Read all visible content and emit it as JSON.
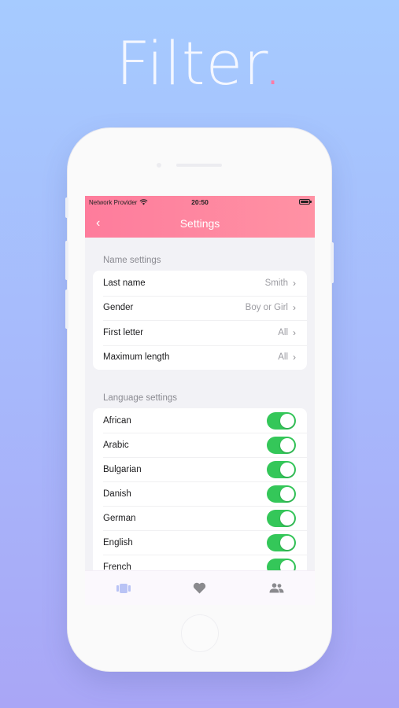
{
  "hero": {
    "title": "Filter",
    "dot": "."
  },
  "status_bar": {
    "carrier": "Network Provider",
    "time": "20:50"
  },
  "nav": {
    "title": "Settings"
  },
  "name_settings": {
    "title": "Name settings",
    "rows": [
      {
        "label": "Last name",
        "value": "Smith"
      },
      {
        "label": "Gender",
        "value": "Boy or Girl"
      },
      {
        "label": "First letter",
        "value": "All"
      },
      {
        "label": "Maximum length",
        "value": "All"
      }
    ]
  },
  "language_settings": {
    "title": "Language settings",
    "rows": [
      {
        "label": "African",
        "enabled": true
      },
      {
        "label": "Arabic",
        "enabled": true
      },
      {
        "label": "Bulgarian",
        "enabled": true
      },
      {
        "label": "Danish",
        "enabled": true
      },
      {
        "label": "German",
        "enabled": true
      },
      {
        "label": "English",
        "enabled": true
      },
      {
        "label": "French",
        "enabled": true
      }
    ]
  },
  "tabbar": {
    "items": [
      "cards-icon",
      "heart-icon",
      "people-icon"
    ],
    "active_color": "#b9c3f5",
    "inactive_color": "#8a8a8e"
  },
  "colors": {
    "accent": "#fe7c9c",
    "toggle_on": "#34c759"
  }
}
